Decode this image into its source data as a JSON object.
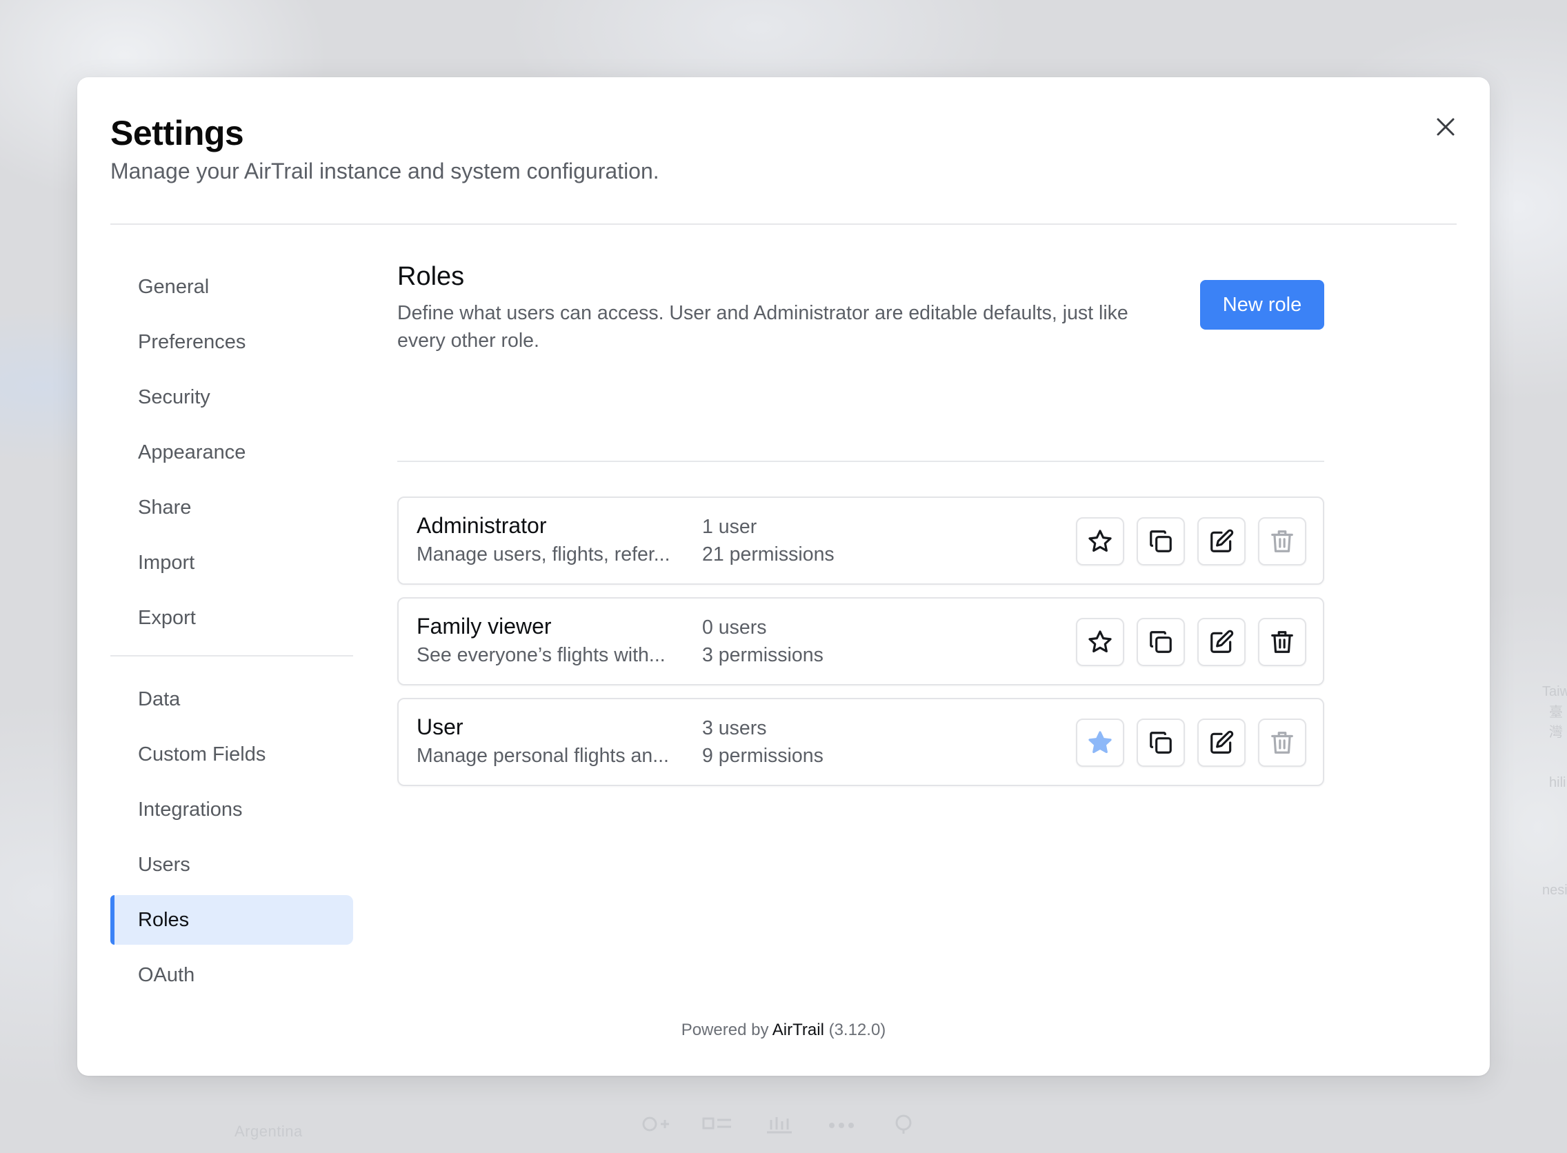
{
  "background": {
    "country_label": "Argentina",
    "map_labels": [
      "Taiw",
      "臺灣",
      "hili",
      "nesi"
    ]
  },
  "modal": {
    "title": "Settings",
    "subtitle": "Manage your AirTrail instance and system configuration."
  },
  "sidebar": {
    "group1": [
      {
        "label": "General"
      },
      {
        "label": "Preferences"
      },
      {
        "label": "Security"
      },
      {
        "label": "Appearance"
      },
      {
        "label": "Share"
      },
      {
        "label": "Import"
      },
      {
        "label": "Export"
      }
    ],
    "group2": [
      {
        "label": "Data"
      },
      {
        "label": "Custom Fields"
      },
      {
        "label": "Integrations"
      },
      {
        "label": "Users"
      },
      {
        "label": "Roles",
        "active": true
      },
      {
        "label": "OAuth"
      }
    ]
  },
  "roles": {
    "title": "Roles",
    "description": "Define what users can access. User and Administrator are editable defaults, just like every other role.",
    "new_button": "New role",
    "items": [
      {
        "name": "Administrator",
        "description": "Manage users, flights, refer...",
        "users": "1 user",
        "permissions": "21 permissions",
        "is_default": false,
        "delete_enabled": false
      },
      {
        "name": "Family viewer",
        "description": "See everyone’s flights with...",
        "users": "0 users",
        "permissions": "3 permissions",
        "is_default": false,
        "delete_enabled": true
      },
      {
        "name": "User",
        "description": "Manage personal flights an...",
        "users": "3 users",
        "permissions": "9 permissions",
        "is_default": true,
        "delete_enabled": false
      }
    ]
  },
  "footer": {
    "prefix": "Powered by",
    "brand": "AirTrail",
    "version": "(3.12.0)"
  },
  "colors": {
    "accent": "#3b82f6",
    "active_nav_bg": "#e1ecfd",
    "default_star": "#8db8f8"
  }
}
